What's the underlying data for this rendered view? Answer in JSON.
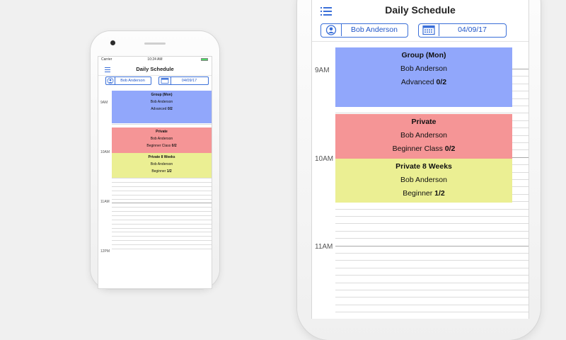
{
  "status": {
    "carrier": "Carrier",
    "time": "10:24 AM"
  },
  "header": {
    "title": "Daily Schedule"
  },
  "filters": {
    "instructor": "Bob Anderson",
    "date": "04/09/17"
  },
  "hours": [
    "9AM",
    "10AM",
    "11AM",
    "12PM"
  ],
  "events": [
    {
      "title": "Group (Mon)",
      "instructor": "Bob Anderson",
      "level": "Advanced",
      "count": "0/2",
      "color": "#91a7fb"
    },
    {
      "title": "Private",
      "instructor": "Bob Anderson",
      "level": "Beginner Class",
      "count": "0/2",
      "color": "#f59596"
    },
    {
      "title": "Private 8 Weeks",
      "instructor": "Bob Anderson",
      "level": "Beginner",
      "count": "1/2",
      "color": "#ebef93"
    }
  ],
  "colors": {
    "accent": "#3a6fd8",
    "background": "#f0f0f0"
  },
  "icons": {
    "menu": "list-menu-icon",
    "instructor": "person-icon",
    "date": "calendar-icon"
  }
}
